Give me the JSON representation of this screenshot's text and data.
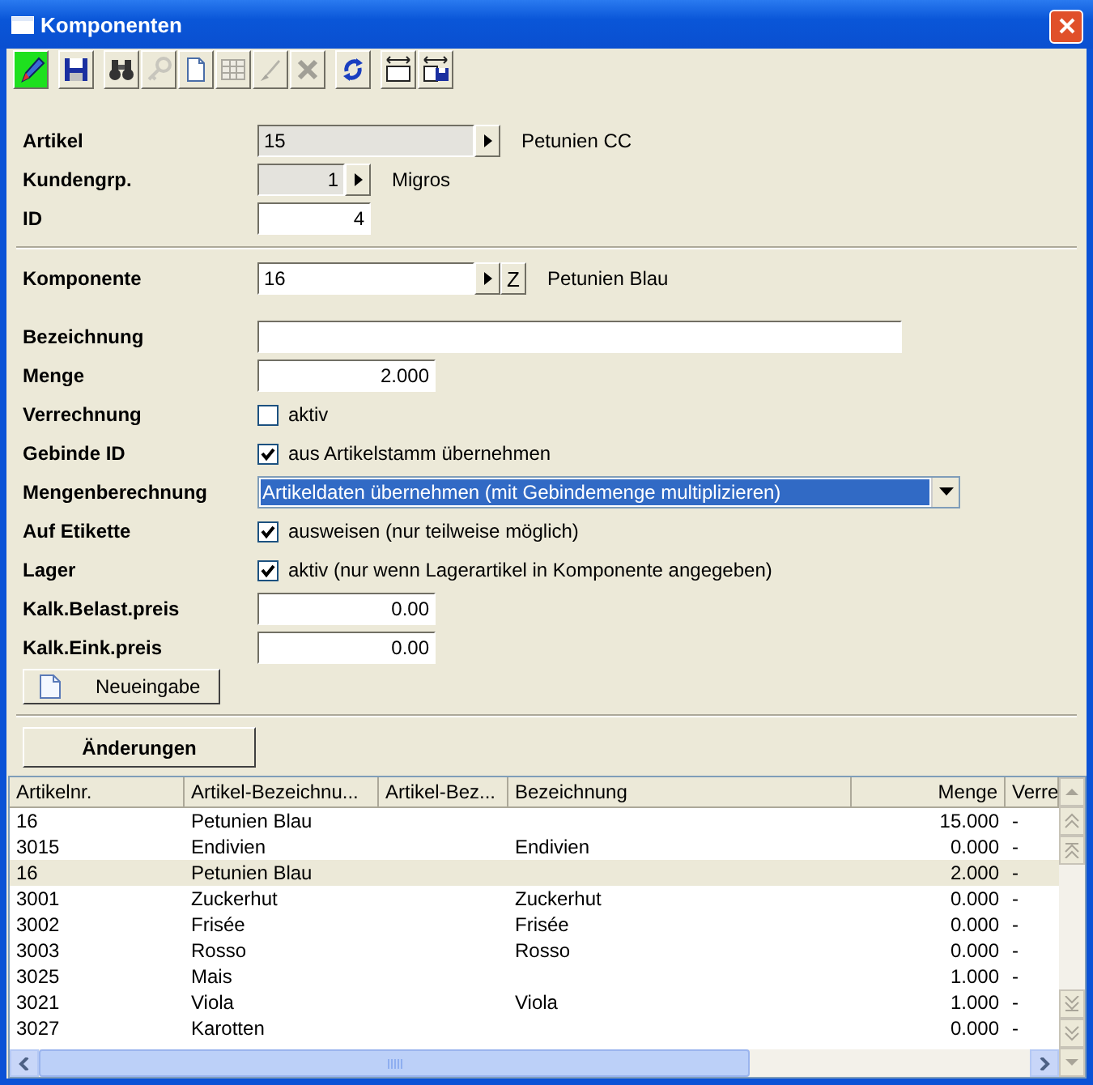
{
  "window": {
    "title": "Komponenten"
  },
  "toolbar": [
    {
      "active": true,
      "disabled": false
    },
    {
      "active": false,
      "disabled": false
    },
    {
      "active": false,
      "disabled": false
    },
    {
      "active": false,
      "disabled": true
    },
    {
      "active": false,
      "disabled": false
    },
    {
      "active": false,
      "disabled": true
    },
    {
      "active": false,
      "disabled": true
    },
    {
      "active": false,
      "disabled": true
    },
    {
      "active": false,
      "disabled": false
    },
    {
      "active": false,
      "disabled": false
    },
    {
      "active": false,
      "disabled": false
    }
  ],
  "form": {
    "sections": [
      {
        "divider_after": true,
        "rows": [
          {
            "kind": "lookup",
            "label": "Artikel",
            "value": "15",
            "readonly": true,
            "note": "Petunien CC"
          },
          {
            "kind": "lookup",
            "label": "Kundengrp.",
            "value": "1",
            "readonly": true,
            "note": "Migros"
          },
          {
            "kind": "field",
            "label": "ID",
            "value": "4",
            "readonly": false
          }
        ]
      },
      {
        "divider_after": false,
        "rows": [
          {
            "kind": "lookup",
            "label": "Komponente",
            "value": "16",
            "readonly": false,
            "extra_button": "Z",
            "note": "Petunien Blau"
          }
        ]
      },
      {
        "divider_after": false,
        "rows": [
          {
            "kind": "field",
            "label": "Bezeichnung",
            "value": "",
            "readonly": false
          },
          {
            "kind": "field",
            "label": "Menge",
            "value": "2.000",
            "readonly": false
          },
          {
            "kind": "checkbox",
            "label": "Verrechnung",
            "checked": false,
            "text": "aktiv"
          },
          {
            "kind": "checkbox",
            "label": "Gebinde ID",
            "checked": true,
            "text": "aus Artikelstamm übernehmen"
          },
          {
            "kind": "select",
            "label": "Mengenberechnung",
            "value": "Artikeldaten übernehmen (mit Gebindemenge multiplizieren)"
          },
          {
            "kind": "checkbox",
            "label": "Auf Etikette",
            "checked": true,
            "text": "ausweisen (nur teilweise möglich)"
          },
          {
            "kind": "checkbox",
            "label": "Lager",
            "checked": true,
            "text": "aktiv (nur wenn Lagerartikel in Komponente angegeben)"
          },
          {
            "kind": "field",
            "label": "Kalk.Belast.preis",
            "value": "0.00",
            "readonly": false
          },
          {
            "kind": "field",
            "label": "Kalk.Eink.preis",
            "value": "0.00",
            "readonly": false
          }
        ]
      }
    ]
  },
  "new_button": "Neueingabe",
  "changes_button": "Änderungen",
  "table": {
    "columns": [
      "Artikelnr.",
      "Artikel-Bezeichnu...",
      "Artikel-Bez...",
      "Bezeichnung",
      "Menge",
      "Verre"
    ],
    "rows": [
      {
        "selected": false,
        "cells": [
          "16",
          "Petunien Blau",
          "",
          "",
          "15.000",
          "-"
        ]
      },
      {
        "selected": false,
        "cells": [
          "3015",
          "Endivien",
          "",
          "Endivien",
          "0.000",
          "-"
        ]
      },
      {
        "selected": true,
        "cells": [
          "16",
          "Petunien Blau",
          "",
          "",
          "2.000",
          "-"
        ]
      },
      {
        "selected": false,
        "cells": [
          "3001",
          "Zuckerhut",
          "",
          "Zuckerhut",
          "0.000",
          "-"
        ]
      },
      {
        "selected": false,
        "cells": [
          "3002",
          "Frisée",
          "",
          "Frisée",
          "0.000",
          "-"
        ]
      },
      {
        "selected": false,
        "cells": [
          "3003",
          "Rosso",
          "",
          "Rosso",
          "0.000",
          "-"
        ]
      },
      {
        "selected": false,
        "cells": [
          "3025",
          "Mais",
          "",
          "",
          "1.000",
          "-"
        ]
      },
      {
        "selected": false,
        "cells": [
          "3021",
          "Viola",
          "",
          "Viola",
          "1.000",
          "-"
        ]
      },
      {
        "selected": false,
        "cells": [
          "3027",
          "Karotten",
          "",
          "",
          "0.000",
          "-"
        ]
      }
    ]
  }
}
